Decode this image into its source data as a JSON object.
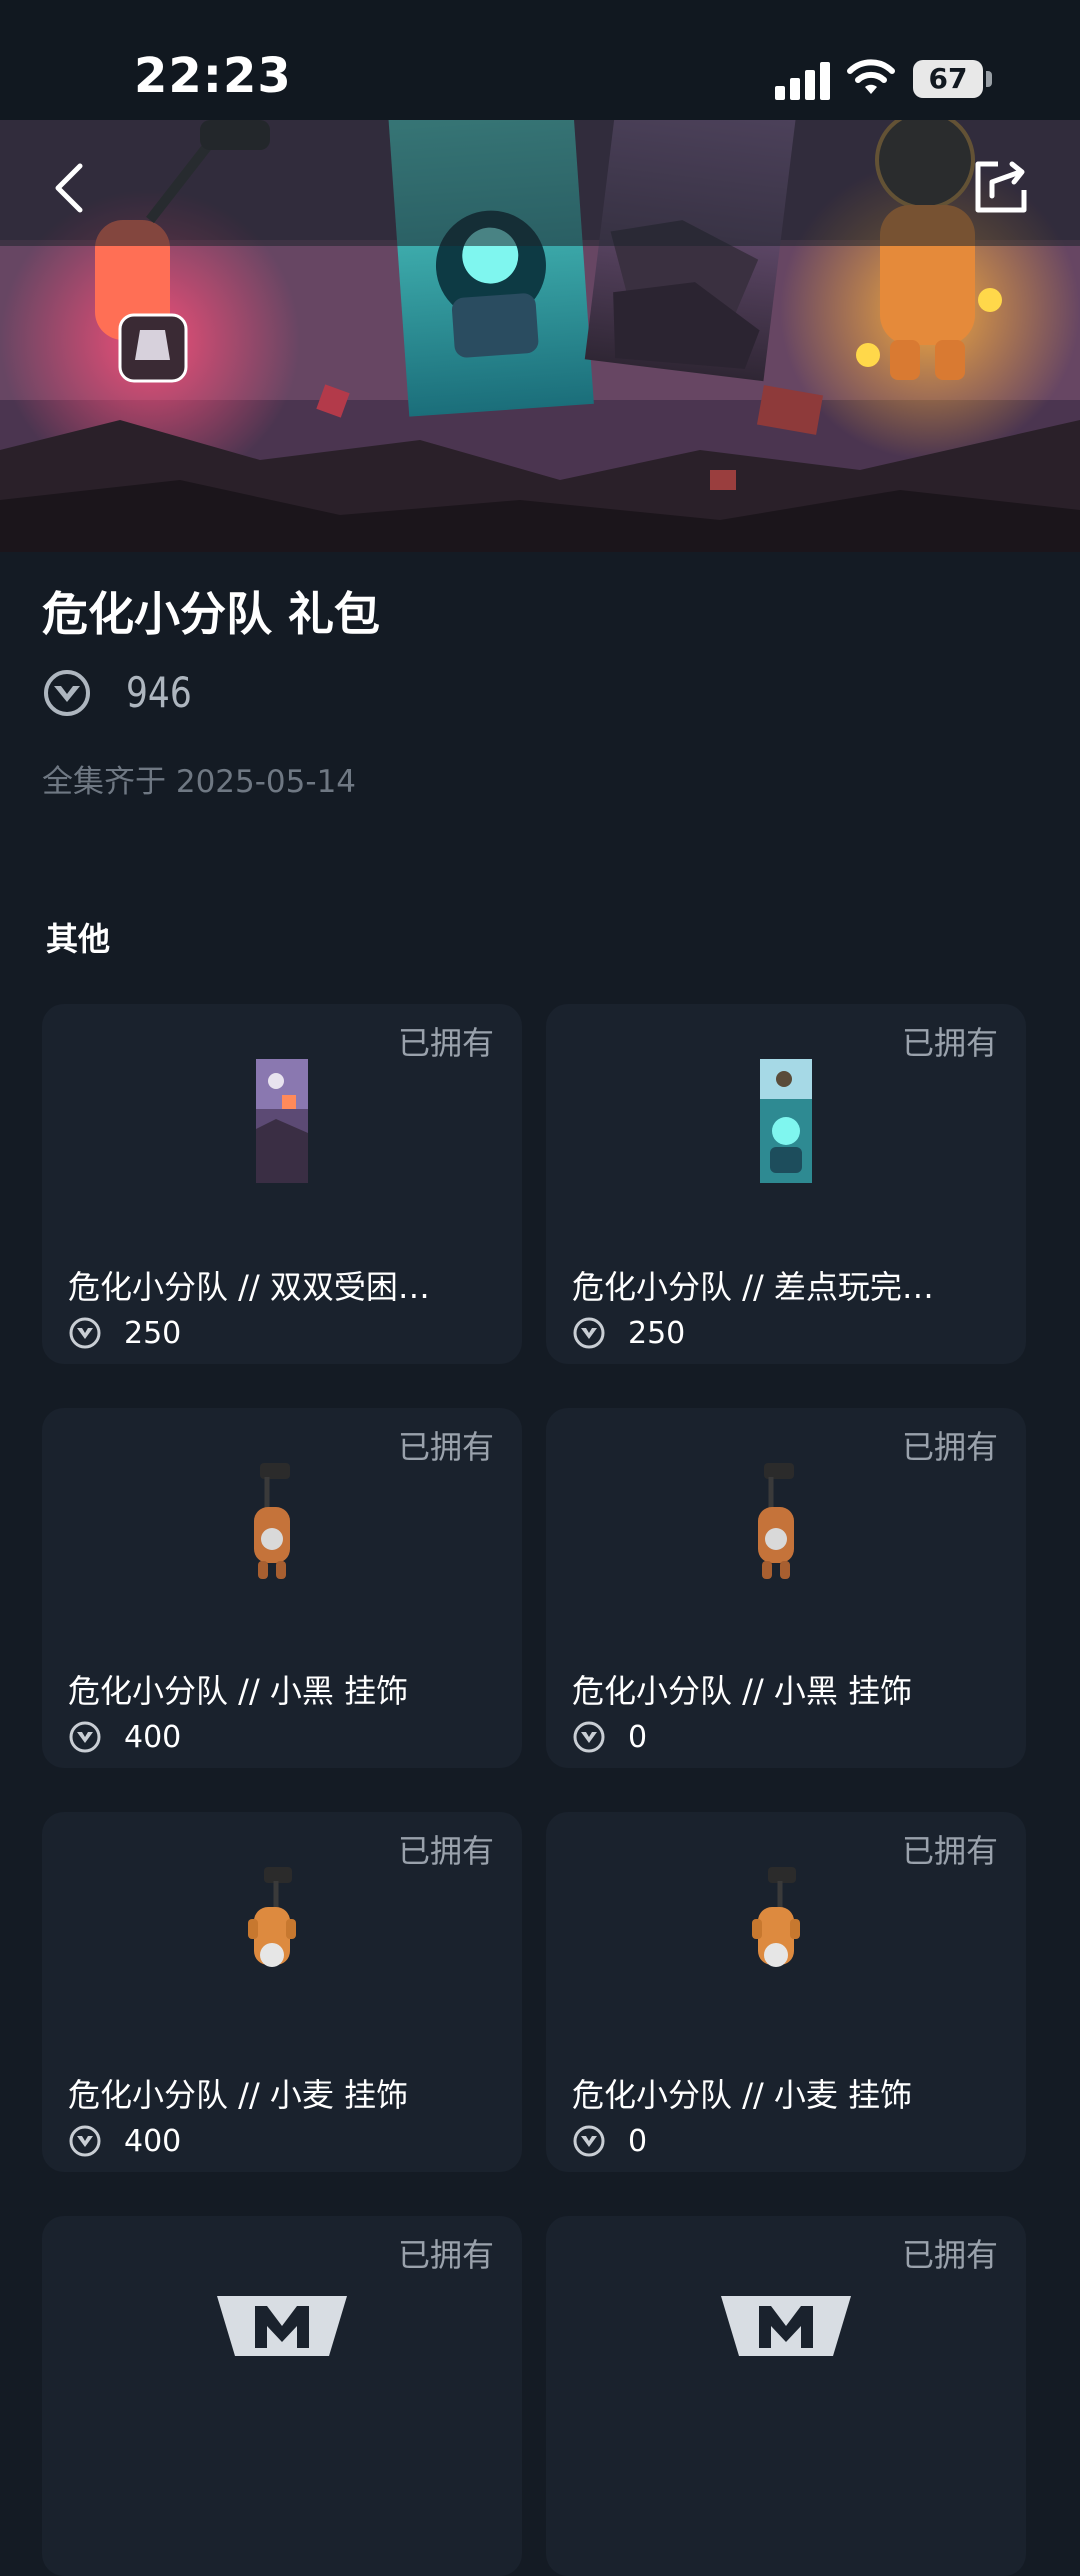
{
  "status_bar": {
    "time": "22:23",
    "battery": "67"
  },
  "bundle": {
    "title": "危化小分队 礼包",
    "price": "946",
    "completed_text": "全集齐于 2025-05-14"
  },
  "section": {
    "title": "其他"
  },
  "items": [
    {
      "owned": "已拥有",
      "name": "危化小分队 // 双双受困…",
      "price": "250",
      "thumb": "card-purple"
    },
    {
      "owned": "已拥有",
      "name": "危化小分队 // 差点玩完…",
      "price": "250",
      "thumb": "card-teal"
    },
    {
      "owned": "已拥有",
      "name": "危化小分队 // 小黑 挂饰",
      "price": "400",
      "thumb": "buddy-black"
    },
    {
      "owned": "已拥有",
      "name": "危化小分队 // 小黑 挂饰",
      "price": "0",
      "thumb": "buddy-black"
    },
    {
      "owned": "已拥有",
      "name": "危化小分队 // 小麦 挂饰",
      "price": "400",
      "thumb": "buddy-wheat"
    },
    {
      "owned": "已拥有",
      "name": "危化小分队 // 小麦 挂饰",
      "price": "0",
      "thumb": "buddy-wheat"
    },
    {
      "owned": "已拥有",
      "name": "",
      "price": "",
      "thumb": "spray-m"
    },
    {
      "owned": "已拥有",
      "name": "",
      "price": "",
      "thumb": "spray-m"
    }
  ],
  "icons": {
    "back": "chevron-left-icon",
    "share": "share-icon",
    "currency": "valorant-points-icon"
  },
  "colors": {
    "background": "#141b24",
    "card": "#1a222d",
    "muted_text": "#9aa2ac"
  }
}
